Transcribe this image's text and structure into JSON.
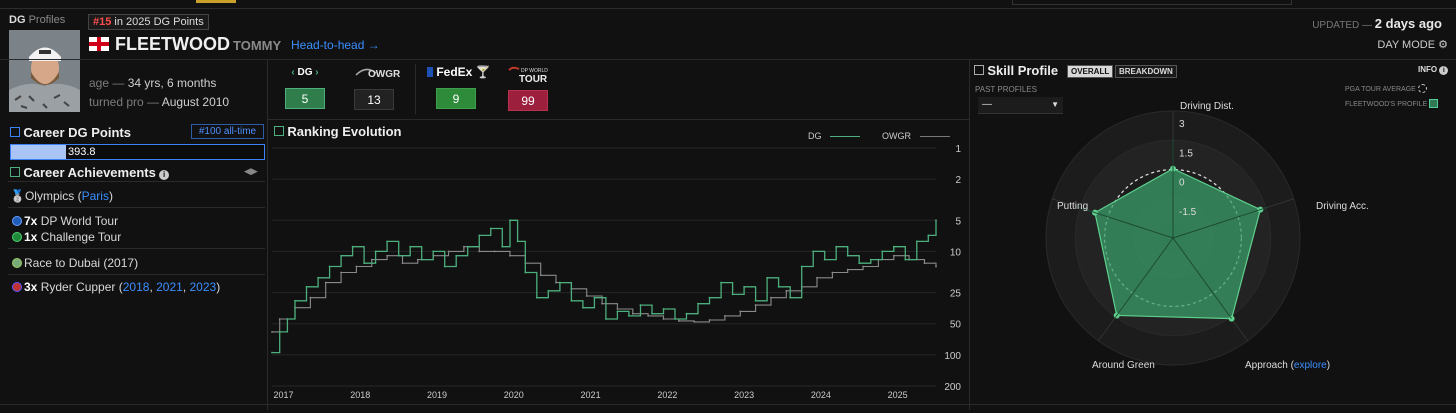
{
  "header": {
    "brand": "DG",
    "brand_suffix": "Profiles",
    "rank_num": "#15",
    "rank_text": "in 2025 DG Points",
    "last_name": "FLEETWOOD",
    "first_name": "TOMMY",
    "h2h": "Head-to-head →",
    "age_label": "age",
    "age_value": "34 yrs, 6 months",
    "turned_pro_label": "turned pro",
    "turned_pro_value": "August 2010",
    "updated_label": "UPDATED",
    "updated_value": "2 days ago",
    "day_mode": "DAY MODE"
  },
  "rankings": [
    {
      "label": "DG",
      "value": "5",
      "color": "#2e7d4a"
    },
    {
      "label": "OWGR",
      "value": "13",
      "color": "#222222"
    },
    {
      "label": "FedEx",
      "value": "9",
      "color": "#2e8b3a"
    },
    {
      "label": "DP WORLD TOUR",
      "value": "99",
      "color": "#9c1f3d"
    }
  ],
  "career": {
    "title": "Career DG Points",
    "alltime": "#100 all-time",
    "points": "393.8",
    "points_fraction": 0.22,
    "achievements_title": "Career Achievements",
    "olympics": "Olympics (",
    "olympics_place": "Paris",
    "olympics_close": ")",
    "dp_count": "7x",
    "dp_label": "DP World Tour",
    "ch_count": "1x",
    "ch_label": "Challenge Tour",
    "race": "Race to Dubai (2017)",
    "ryder_count": "3x",
    "ryder_label": "Ryder Cupper (",
    "ryder_years": [
      "2018",
      "2021",
      "2023"
    ],
    "ryder_close": ")"
  },
  "chart": {
    "title": "Ranking Evolution",
    "legend_dg": "DG",
    "legend_owgr": "OWGR",
    "y_ticks": [
      "1",
      "2",
      "5",
      "10",
      "25",
      "50",
      "100",
      "200"
    ],
    "x_ticks": [
      "2017",
      "2018",
      "2019",
      "2020",
      "2021",
      "2022",
      "2023",
      "2024",
      "2025"
    ]
  },
  "chart_data": {
    "type": "line",
    "title": "Ranking Evolution",
    "xlabel": "",
    "ylabel": "",
    "y_scale": "log",
    "y_reversed": true,
    "ylim": [
      1,
      200
    ],
    "xlim": [
      2016.9,
      2025.55
    ],
    "series": [
      {
        "name": "DG",
        "color": "#4caf7d",
        "x": [
          2016.9,
          2017.0,
          2017.1,
          2017.2,
          2017.35,
          2017.5,
          2017.65,
          2017.8,
          2017.95,
          2018.1,
          2018.25,
          2018.4,
          2018.55,
          2018.7,
          2018.85,
          2019.0,
          2019.15,
          2019.3,
          2019.45,
          2019.6,
          2019.75,
          2019.9,
          2020.0,
          2020.1,
          2020.2,
          2020.35,
          2020.5,
          2020.65,
          2020.8,
          2020.95,
          2021.1,
          2021.25,
          2021.4,
          2021.55,
          2021.7,
          2021.85,
          2022.0,
          2022.15,
          2022.3,
          2022.45,
          2022.6,
          2022.75,
          2022.9,
          2023.05,
          2023.2,
          2023.35,
          2023.5,
          2023.65,
          2023.8,
          2023.95,
          2024.1,
          2024.25,
          2024.4,
          2024.55,
          2024.7,
          2024.85,
          2025.0,
          2025.15,
          2025.3,
          2025.45,
          2025.55
        ],
        "values": [
          95,
          60,
          45,
          30,
          22,
          18,
          14,
          11,
          9,
          13,
          10,
          8,
          11,
          9,
          12,
          10,
          14,
          11,
          9,
          7,
          6,
          9,
          5,
          8,
          16,
          28,
          24,
          20,
          30,
          35,
          28,
          45,
          38,
          42,
          33,
          40,
          36,
          45,
          40,
          32,
          28,
          20,
          26,
          22,
          30,
          18,
          22,
          28,
          14,
          10,
          12,
          9,
          11,
          13,
          12,
          10,
          9,
          12,
          8,
          7,
          5
        ]
      },
      {
        "name": "OWGR",
        "color": "#8a8a8a",
        "x": [
          2016.9,
          2017.0,
          2017.2,
          2017.4,
          2017.6,
          2017.8,
          2018.0,
          2018.2,
          2018.4,
          2018.6,
          2018.8,
          2019.0,
          2019.2,
          2019.4,
          2019.6,
          2019.8,
          2020.0,
          2020.2,
          2020.4,
          2020.6,
          2020.8,
          2021.0,
          2021.2,
          2021.4,
          2021.6,
          2021.8,
          2022.0,
          2022.2,
          2022.4,
          2022.6,
          2022.8,
          2023.0,
          2023.2,
          2023.4,
          2023.6,
          2023.8,
          2024.0,
          2024.2,
          2024.4,
          2024.6,
          2024.8,
          2025.0,
          2025.2,
          2025.4,
          2025.55
        ],
        "values": [
          60,
          45,
          35,
          28,
          20,
          16,
          14,
          12,
          11,
          13,
          12,
          11,
          10,
          9,
          10,
          10,
          11,
          13,
          17,
          20,
          23,
          27,
          32,
          36,
          40,
          42,
          45,
          47,
          48,
          46,
          42,
          38,
          33,
          28,
          24,
          22,
          18,
          16,
          15,
          14,
          12,
          11,
          12,
          13,
          14
        ]
      }
    ]
  },
  "skill": {
    "title": "Skill Profile",
    "tab_overall": "OVERALL",
    "tab_breakdown": "BREAKDOWN",
    "info": "INFO",
    "past_profiles": "PAST PROFILES",
    "past_profiles_value": "—",
    "legend_avg": "PGA TOUR AVERAGE",
    "legend_player": "FLEETWOOD'S PROFILE",
    "labels": {
      "driving_dist": "Driving Dist.",
      "driving_acc": "Driving Acc.",
      "approach": "Approach (",
      "approach_link": "explore",
      "approach_close": ")",
      "around_green": "Around Green",
      "putting": "Putting"
    },
    "ring_labels": [
      "3",
      "1.5",
      "0",
      "-1.5"
    ],
    "values": {
      "driving_dist": 0.05,
      "driving_acc": 1.2,
      "approach": 1.6,
      "around_green": 1.4,
      "putting": 0.7
    },
    "fill_color": "#3a9e68"
  }
}
